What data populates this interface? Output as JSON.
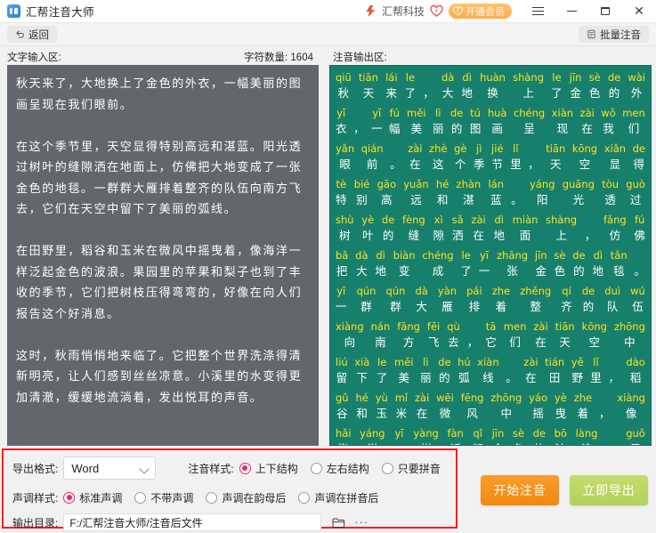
{
  "window": {
    "title": "汇帮注音大师",
    "app_icon": "app-logo-icon",
    "brand_name": "汇帮科技",
    "vip_label": "开通会员",
    "menu_icon": "hamburger-icon",
    "minimize_icon": "minimize-icon",
    "maximize_icon": "maximize-icon",
    "close_icon": "close-icon"
  },
  "toolbar": {
    "back_label": "返回",
    "back_icon": "undo-arrow-icon",
    "batch_label": "批量注音",
    "batch_icon": "document-icon"
  },
  "input_pane": {
    "label": "文字输入区:",
    "char_count_label": "字符数量:",
    "char_count_value": "1604",
    "text": "秋天来了，大地换上了金色的外衣，一幅美丽的图画呈现在我们眼前。\n\n在这个季节里，天空显得特别高远和湛蓝。阳光透过树叶的缝隙洒在地面上，仿佛把大地变成了一张金色的地毯。一群群大雁排着整齐的队伍向南方飞去，它们在天空中留下了美丽的弧线。\n\n在田野里，稻谷和玉米在微风中摇曳着，像海洋一样泛起金色的波浪。果园里的苹果和梨子也到了丰收的季节，它们把树枝压得弯弯的，好像在向人们报告这个好消息。\n\n这时，秋雨悄悄地来临了。它把整个世界洗涤得清新明亮，让人们感到丝丝凉意。小溪里的水变得更加清澈，缓缓地流淌着，发出悦耳的声音。"
  },
  "output_pane": {
    "label": "注音输出区:",
    "lines": [
      [
        {
          "p": "qiū",
          "h": "秋"
        },
        {
          "p": "tiān",
          "h": "天"
        },
        {
          "p": "lái",
          "h": "来"
        },
        {
          "p": "le",
          "h": "了"
        },
        {
          "p": "",
          "h": "，"
        },
        {
          "p": "dà",
          "h": "大"
        },
        {
          "p": "dì",
          "h": "地"
        },
        {
          "p": "huàn",
          "h": "换"
        },
        {
          "p": "shàng",
          "h": "上"
        },
        {
          "p": "le",
          "h": "了"
        },
        {
          "p": "jīn",
          "h": "金"
        },
        {
          "p": "sè",
          "h": "色"
        },
        {
          "p": "de",
          "h": "的"
        },
        {
          "p": "wài",
          "h": "外"
        }
      ],
      [
        {
          "p": "yī",
          "h": "衣"
        },
        {
          "p": "",
          "h": "，"
        },
        {
          "p": "yī",
          "h": "一"
        },
        {
          "p": "fú",
          "h": "幅"
        },
        {
          "p": "měi",
          "h": "美"
        },
        {
          "p": "lì",
          "h": "丽"
        },
        {
          "p": "de",
          "h": "的"
        },
        {
          "p": "tú",
          "h": "图"
        },
        {
          "p": "huà",
          "h": "画"
        },
        {
          "p": "chéng",
          "h": "呈"
        },
        {
          "p": "xiàn",
          "h": "现"
        },
        {
          "p": "zài",
          "h": "在"
        },
        {
          "p": "wǒ",
          "h": "我"
        },
        {
          "p": "men",
          "h": "们"
        }
      ],
      [
        {
          "p": "yǎn",
          "h": "眼"
        },
        {
          "p": "qián",
          "h": "前"
        },
        {
          "p": "",
          "h": "。"
        },
        {
          "p": "zài",
          "h": "在"
        },
        {
          "p": "zhè",
          "h": "这"
        },
        {
          "p": "gè",
          "h": "个"
        },
        {
          "p": "jì",
          "h": "季"
        },
        {
          "p": "jié",
          "h": "节"
        },
        {
          "p": "lǐ",
          "h": "里"
        },
        {
          "p": "",
          "h": "，"
        },
        {
          "p": "tiān",
          "h": "天"
        },
        {
          "p": "kōng",
          "h": "空"
        },
        {
          "p": "xiǎn",
          "h": "显"
        },
        {
          "p": "de",
          "h": "得"
        }
      ],
      [
        {
          "p": "tè",
          "h": "特"
        },
        {
          "p": "bié",
          "h": "别"
        },
        {
          "p": "gāo",
          "h": "高"
        },
        {
          "p": "yuǎn",
          "h": "远"
        },
        {
          "p": "hé",
          "h": "和"
        },
        {
          "p": "zhàn",
          "h": "湛"
        },
        {
          "p": "lán",
          "h": "蓝"
        },
        {
          "p": "",
          "h": "。"
        },
        {
          "p": "yáng",
          "h": "阳"
        },
        {
          "p": "guāng",
          "h": "光"
        },
        {
          "p": "tòu",
          "h": "透"
        },
        {
          "p": "guò",
          "h": "过"
        }
      ],
      [
        {
          "p": "shù",
          "h": "树"
        },
        {
          "p": "yè",
          "h": "叶"
        },
        {
          "p": "de",
          "h": "的"
        },
        {
          "p": "fèng",
          "h": "缝"
        },
        {
          "p": "xì",
          "h": "隙"
        },
        {
          "p": "sǎ",
          "h": "洒"
        },
        {
          "p": "zài",
          "h": "在"
        },
        {
          "p": "dì",
          "h": "地"
        },
        {
          "p": "miàn",
          "h": "面"
        },
        {
          "p": "shàng",
          "h": "上"
        },
        {
          "p": "",
          "h": "，"
        },
        {
          "p": "fǎng",
          "h": "仿"
        },
        {
          "p": "fú",
          "h": "佛"
        }
      ],
      [
        {
          "p": "bǎ",
          "h": "把"
        },
        {
          "p": "dà",
          "h": "大"
        },
        {
          "p": "dì",
          "h": "地"
        },
        {
          "p": "biàn",
          "h": "变"
        },
        {
          "p": "chéng",
          "h": "成"
        },
        {
          "p": "le",
          "h": "了"
        },
        {
          "p": "yī",
          "h": "一"
        },
        {
          "p": "zhāng",
          "h": "张"
        },
        {
          "p": "jīn",
          "h": "金"
        },
        {
          "p": "sè",
          "h": "色"
        },
        {
          "p": "de",
          "h": "的"
        },
        {
          "p": "dì",
          "h": "地"
        },
        {
          "p": "tǎn",
          "h": "毯"
        },
        {
          "p": "",
          "h": "。"
        }
      ],
      [
        {
          "p": "yī",
          "h": "一"
        },
        {
          "p": "qún",
          "h": "群"
        },
        {
          "p": "qún",
          "h": "群"
        },
        {
          "p": "dà",
          "h": "大"
        },
        {
          "p": "yàn",
          "h": "雁"
        },
        {
          "p": "pái",
          "h": "排"
        },
        {
          "p": "zhe",
          "h": "着"
        },
        {
          "p": "zhěng",
          "h": "整"
        },
        {
          "p": "qí",
          "h": "齐"
        },
        {
          "p": "de",
          "h": "的"
        },
        {
          "p": "duì",
          "h": "队"
        },
        {
          "p": "wú",
          "h": "伍"
        }
      ],
      [
        {
          "p": "xiàng",
          "h": "向"
        },
        {
          "p": "nán",
          "h": "南"
        },
        {
          "p": "fāng",
          "h": "方"
        },
        {
          "p": "fēi",
          "h": "飞"
        },
        {
          "p": "qù",
          "h": "去"
        },
        {
          "p": "",
          "h": "，"
        },
        {
          "p": "tā",
          "h": "它"
        },
        {
          "p": "men",
          "h": "们"
        },
        {
          "p": "zài",
          "h": "在"
        },
        {
          "p": "tiān",
          "h": "天"
        },
        {
          "p": "kōng",
          "h": "空"
        },
        {
          "p": "zhōng",
          "h": "中"
        }
      ],
      [
        {
          "p": "liú",
          "h": "留"
        },
        {
          "p": "xià",
          "h": "下"
        },
        {
          "p": "le",
          "h": "了"
        },
        {
          "p": "měi",
          "h": "美"
        },
        {
          "p": "lì",
          "h": "丽"
        },
        {
          "p": "de",
          "h": "的"
        },
        {
          "p": "hú",
          "h": "弧"
        },
        {
          "p": "xiàn",
          "h": "线"
        },
        {
          "p": "",
          "h": "。"
        },
        {
          "p": "zài",
          "h": "在"
        },
        {
          "p": "tián",
          "h": "田"
        },
        {
          "p": "yě",
          "h": "野"
        },
        {
          "p": "lǐ",
          "h": "里"
        },
        {
          "p": "",
          "h": "，"
        },
        {
          "p": "dào",
          "h": "稻"
        }
      ],
      [
        {
          "p": "gǔ",
          "h": "谷"
        },
        {
          "p": "hé",
          "h": "和"
        },
        {
          "p": "yù",
          "h": "玉"
        },
        {
          "p": "mǐ",
          "h": "米"
        },
        {
          "p": "zài",
          "h": "在"
        },
        {
          "p": "wēi",
          "h": "微"
        },
        {
          "p": "fēng",
          "h": "风"
        },
        {
          "p": "zhōng",
          "h": "中"
        },
        {
          "p": "yáo",
          "h": "摇"
        },
        {
          "p": "yè",
          "h": "曳"
        },
        {
          "p": "zhe",
          "h": "着"
        },
        {
          "p": "",
          "h": "，"
        },
        {
          "p": "xiàng",
          "h": "像"
        }
      ],
      [
        {
          "p": "hǎi",
          "h": "海"
        },
        {
          "p": "yáng",
          "h": "洋"
        },
        {
          "p": "yī",
          "h": "一"
        },
        {
          "p": "yàng",
          "h": "样"
        },
        {
          "p": "fàn",
          "h": "泛"
        },
        {
          "p": "qǐ",
          "h": "起"
        },
        {
          "p": "jīn",
          "h": "金"
        },
        {
          "p": "sè",
          "h": "色"
        },
        {
          "p": "de",
          "h": "的"
        },
        {
          "p": "bō",
          "h": "波"
        },
        {
          "p": "làng",
          "h": "浪"
        },
        {
          "p": "",
          "h": "。"
        },
        {
          "p": "guǒ",
          "h": "果"
        }
      ]
    ]
  },
  "settings": {
    "export_format_label": "导出格式:",
    "export_format_value": "Word",
    "phonetic_style_label": "注音样式:",
    "phonetic_style_options": [
      {
        "label": "上下结构",
        "selected": true
      },
      {
        "label": "左右结构",
        "selected": false
      },
      {
        "label": "只要拼音",
        "selected": false
      }
    ],
    "tone_style_label": "声调样式:",
    "tone_style_options": [
      {
        "label": "标准声调",
        "selected": true
      },
      {
        "label": "不带声调",
        "selected": false
      },
      {
        "label": "声调在韵母后",
        "selected": false
      },
      {
        "label": "声调在拼音后",
        "selected": false
      }
    ],
    "output_dir_label": "输出目录:",
    "output_dir_value": "F:/汇帮注音大师/注音后文件",
    "folder_icon": "folder-icon",
    "more_icon": "ellipsis-icon",
    "highlight_color": "#ff1b1b",
    "radio_accent": "#e8246d"
  },
  "actions": {
    "start_label": "开始注音",
    "export_label": "立即导出",
    "start_color": "#f5941f",
    "export_color": "#bdd667"
  },
  "theme": {
    "input_bg": "#63666b",
    "output_bg": "#17806c",
    "pinyin_color": "#ffe11f",
    "hanzi_color": "#ffffff"
  }
}
